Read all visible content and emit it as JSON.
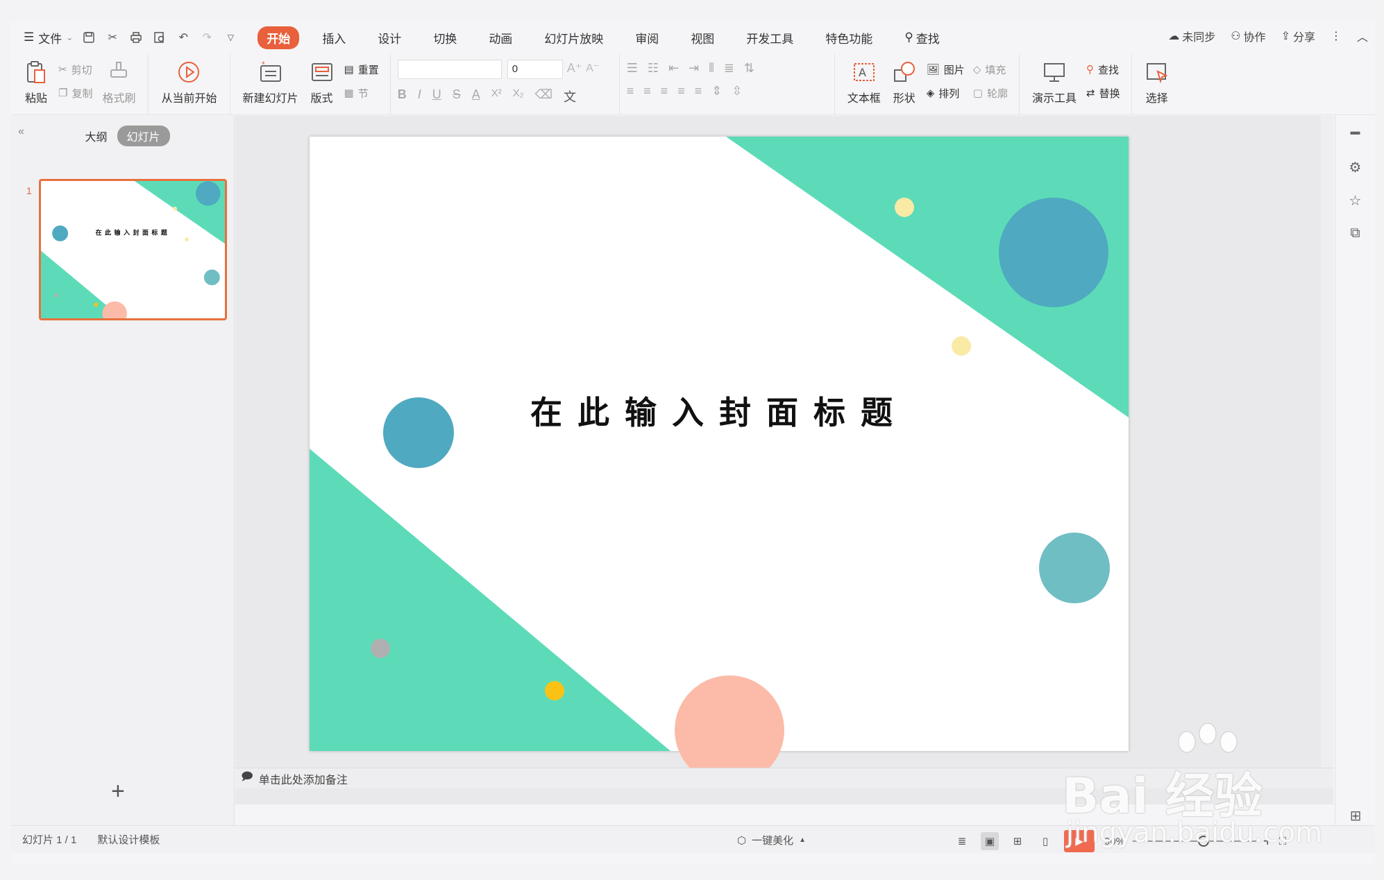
{
  "menubar": {
    "file_label": "文件",
    "tabs": [
      {
        "label": "开始",
        "active": true
      },
      {
        "label": "插入"
      },
      {
        "label": "设计"
      },
      {
        "label": "切换"
      },
      {
        "label": "动画"
      },
      {
        "label": "幻灯片放映"
      },
      {
        "label": "审阅"
      },
      {
        "label": "视图"
      },
      {
        "label": "开发工具"
      },
      {
        "label": "特色功能"
      }
    ],
    "search_label": "查找",
    "right": {
      "sync": "未同步",
      "collab": "协作",
      "share": "分享"
    }
  },
  "ribbon": {
    "paste": "粘贴",
    "cut": "剪切",
    "copy": "复制",
    "format_painter": "格式刷",
    "from_current": "从当前开始",
    "new_slide": "新建幻灯片",
    "layout": "版式",
    "reset": "重置",
    "section": "节",
    "font_size": "0",
    "textbox": "文本框",
    "shape": "形状",
    "picture": "图片",
    "fill": "填充",
    "arrange": "排列",
    "outline": "轮廓",
    "presenter_tools": "演示工具",
    "find": "查找",
    "replace": "替换",
    "select": "选择",
    "format_buttons": [
      "B",
      "I",
      "U",
      "S",
      "A",
      "X²",
      "X₂"
    ]
  },
  "leftpanel": {
    "tab_outline": "大纲",
    "tab_slides": "幻灯片",
    "slide_number": "1"
  },
  "slide": {
    "title": "在此输入封面标题",
    "colors": {
      "green": "#5ddbb8",
      "blue_dark": "#4fa9c0",
      "blue_light": "#6fbec4",
      "peach": "#fcbba8",
      "yellow_pale": "#f9eaa6",
      "yellow": "#fac214",
      "gray": "#b0b0b0"
    }
  },
  "notes_placeholder": "单击此处添加备注",
  "statusbar": {
    "slide_info": "幻灯片 1 / 1",
    "template": "默认设计模板",
    "beautify": "一键美化",
    "zoom": "90%"
  },
  "watermark": {
    "brand": "Bai  经验",
    "url": "jingyan.baidu.com"
  }
}
